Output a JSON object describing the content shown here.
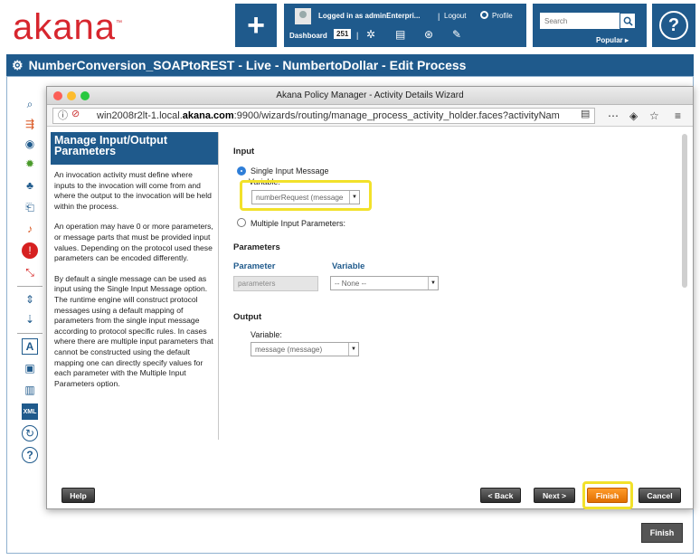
{
  "brand": {
    "logo_text": "akana",
    "accent": "#d7262e",
    "primary": "#1f5a8c"
  },
  "header": {
    "add_label": "+",
    "logged_in": "Logged in as adminEnterpri...",
    "logout": "Logout",
    "profile": "Profile",
    "dashboard": "Dashboard",
    "dashboard_count": "251",
    "search_placeholder": "Search",
    "popular": "Popular ▸",
    "help": "?"
  },
  "page": {
    "title": "NumberConversion_SOAPtoREST - Live - NumbertoDollar - Edit Process"
  },
  "dialog": {
    "window_title": "Akana Policy Manager - Activity Details Wizard",
    "url_prefix": "win2008r2lt-1.local.",
    "url_domain": "akana.com",
    "url_suffix": ":9900/wizards/routing/manage_process_activity_holder.faces?activityNam"
  },
  "info": {
    "heading": "Manage Input/Output Parameters",
    "paragraphs": [
      "An invocation activity must define where inputs to the invocation will come from and where the output to the invocation will be held within the process.",
      "An operation may have 0 or more parameters, or message parts that must be provided input values. Depending on the protocol used these parameters can be encoded differently.",
      "By default a single message can be used as input using the Single Input Message option. The runtime engine will construct protocol messages using a default mapping of parameters from the single input message according to protocol specific rules. In cases where there are multiple input parameters that cannot be constructed using the default mapping one can directly specify values for each parameter with the Multiple Input Parameters option."
    ]
  },
  "form": {
    "input_heading": "Input",
    "single_input": "Single Input Message",
    "variable_label": "Variable:",
    "input_variable_value": "numberRequest (message",
    "multiple_input": "Multiple Input Parameters:",
    "parameters_heading": "Parameters",
    "col_parameter": "Parameter",
    "col_variable": "Variable",
    "param_value": "parameters",
    "param_variable_value": "-- None --",
    "output_heading": "Output",
    "output_variable_label": "Variable:",
    "output_variable_value": "message (message)"
  },
  "buttons": {
    "help": "Help",
    "back": "< Back",
    "next": "Next >",
    "finish": "Finish",
    "cancel": "Cancel",
    "outer_finish": "Finish"
  },
  "rail_icons": [
    "search-doc-icon",
    "flow-icon",
    "contract-icon",
    "settings-icon",
    "hierarchy-icon",
    "import-icon",
    "script-icon",
    "alert-icon",
    "resize-icon",
    "expand-icon",
    "collapse-icon",
    "text-icon",
    "save-icon",
    "delete-icon",
    "xml-icon",
    "refresh-icon",
    "help-icon"
  ]
}
